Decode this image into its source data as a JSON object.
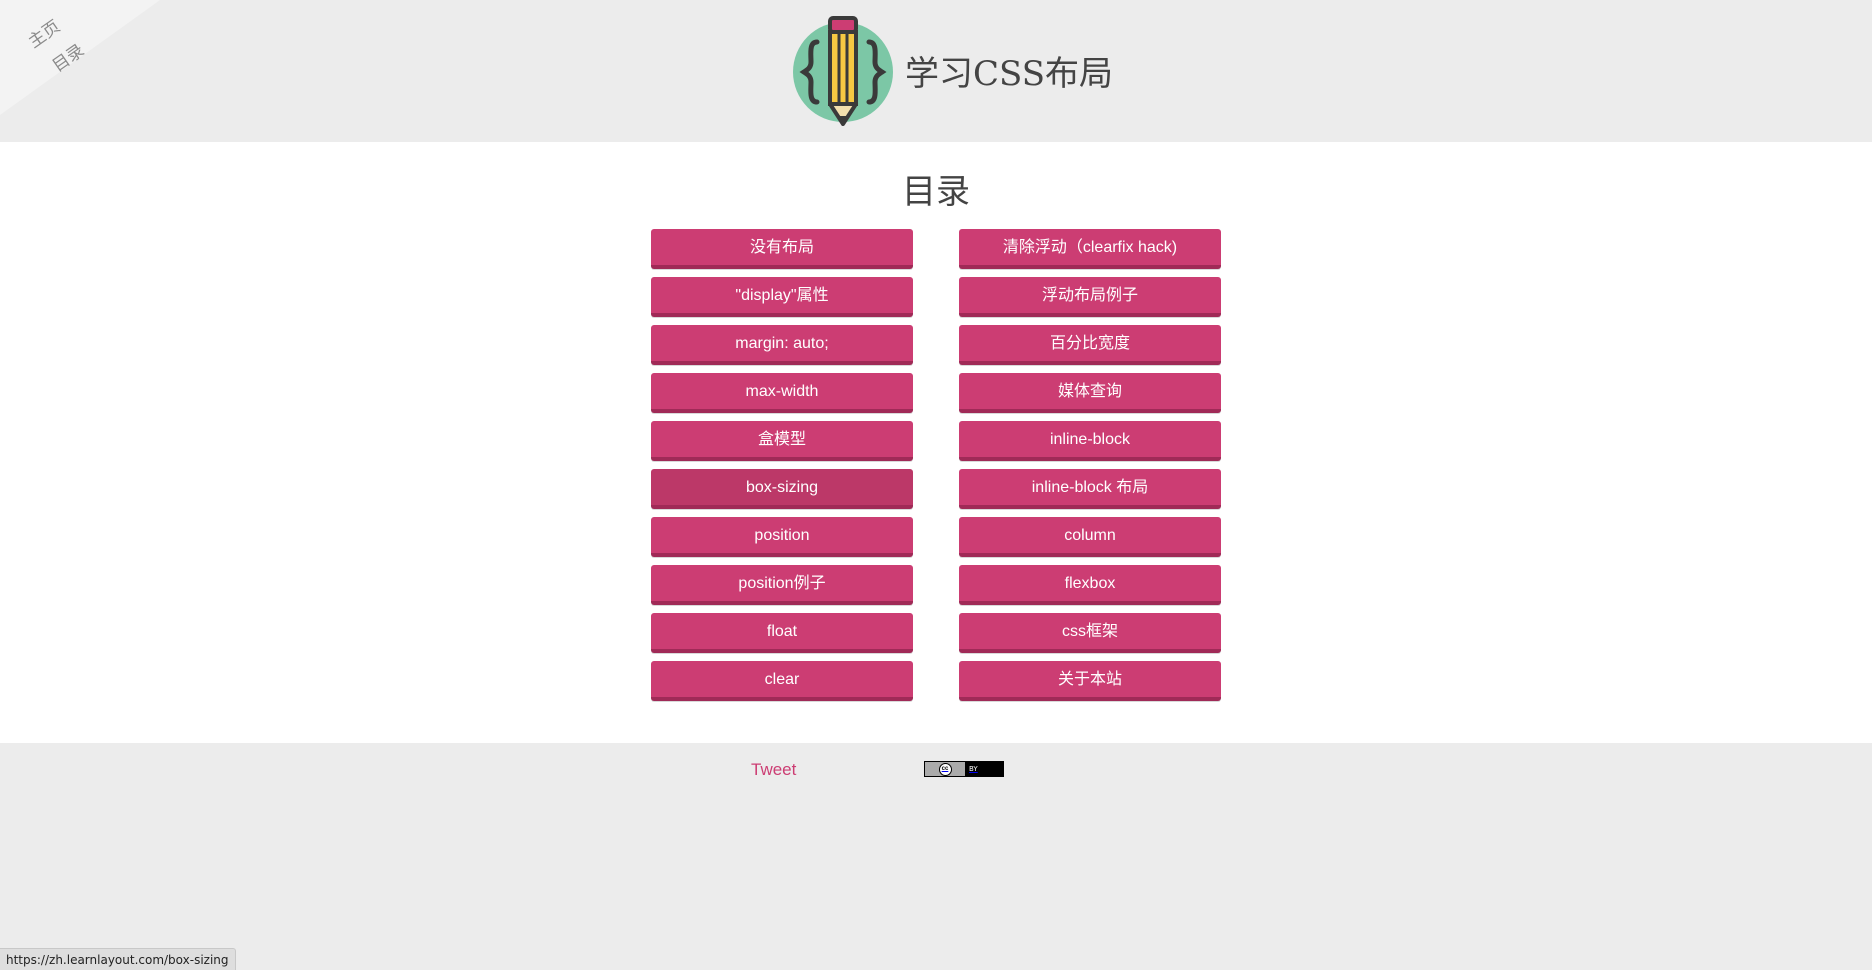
{
  "corner": {
    "home_label": "主页",
    "toc_label": "目录"
  },
  "header": {
    "logo_icon": "pencil-braces-icon",
    "title": "学习CSS布局",
    "colors": {
      "circle": "#7cc7a6",
      "pencil_body": "#f6c843",
      "pencil_eraser": "#cc3d73",
      "outline": "#3a3a3a"
    }
  },
  "main": {
    "heading": "目录",
    "left_column": [
      {
        "label": "没有布局",
        "active": false
      },
      {
        "label": "\"display\"属性",
        "active": false
      },
      {
        "label": "margin: auto;",
        "active": false
      },
      {
        "label": "max-width",
        "active": false
      },
      {
        "label": "盒模型",
        "active": false
      },
      {
        "label": "box-sizing",
        "active": true
      },
      {
        "label": "position",
        "active": false
      },
      {
        "label": "position例子",
        "active": false
      },
      {
        "label": "float",
        "active": false
      },
      {
        "label": "clear",
        "active": false
      }
    ],
    "right_column": [
      {
        "label": "清除浮动（clearfix hack)",
        "active": false
      },
      {
        "label": "浮动布局例子",
        "active": false
      },
      {
        "label": "百分比宽度",
        "active": false
      },
      {
        "label": "媒体查询",
        "active": false
      },
      {
        "label": "inline-block",
        "active": false
      },
      {
        "label": "inline-block 布局",
        "active": false
      },
      {
        "label": "column",
        "active": false
      },
      {
        "label": "flexbox",
        "active": false
      },
      {
        "label": "css框架",
        "active": false
      },
      {
        "label": "关于本站",
        "active": false
      }
    ],
    "button_color": "#cc3d73"
  },
  "footer": {
    "tweet_label": "Tweet",
    "license_badge_text": "BY",
    "license_badge_cc": "cc"
  },
  "status": {
    "url": "https://zh.learnlayout.com/box-sizing"
  }
}
